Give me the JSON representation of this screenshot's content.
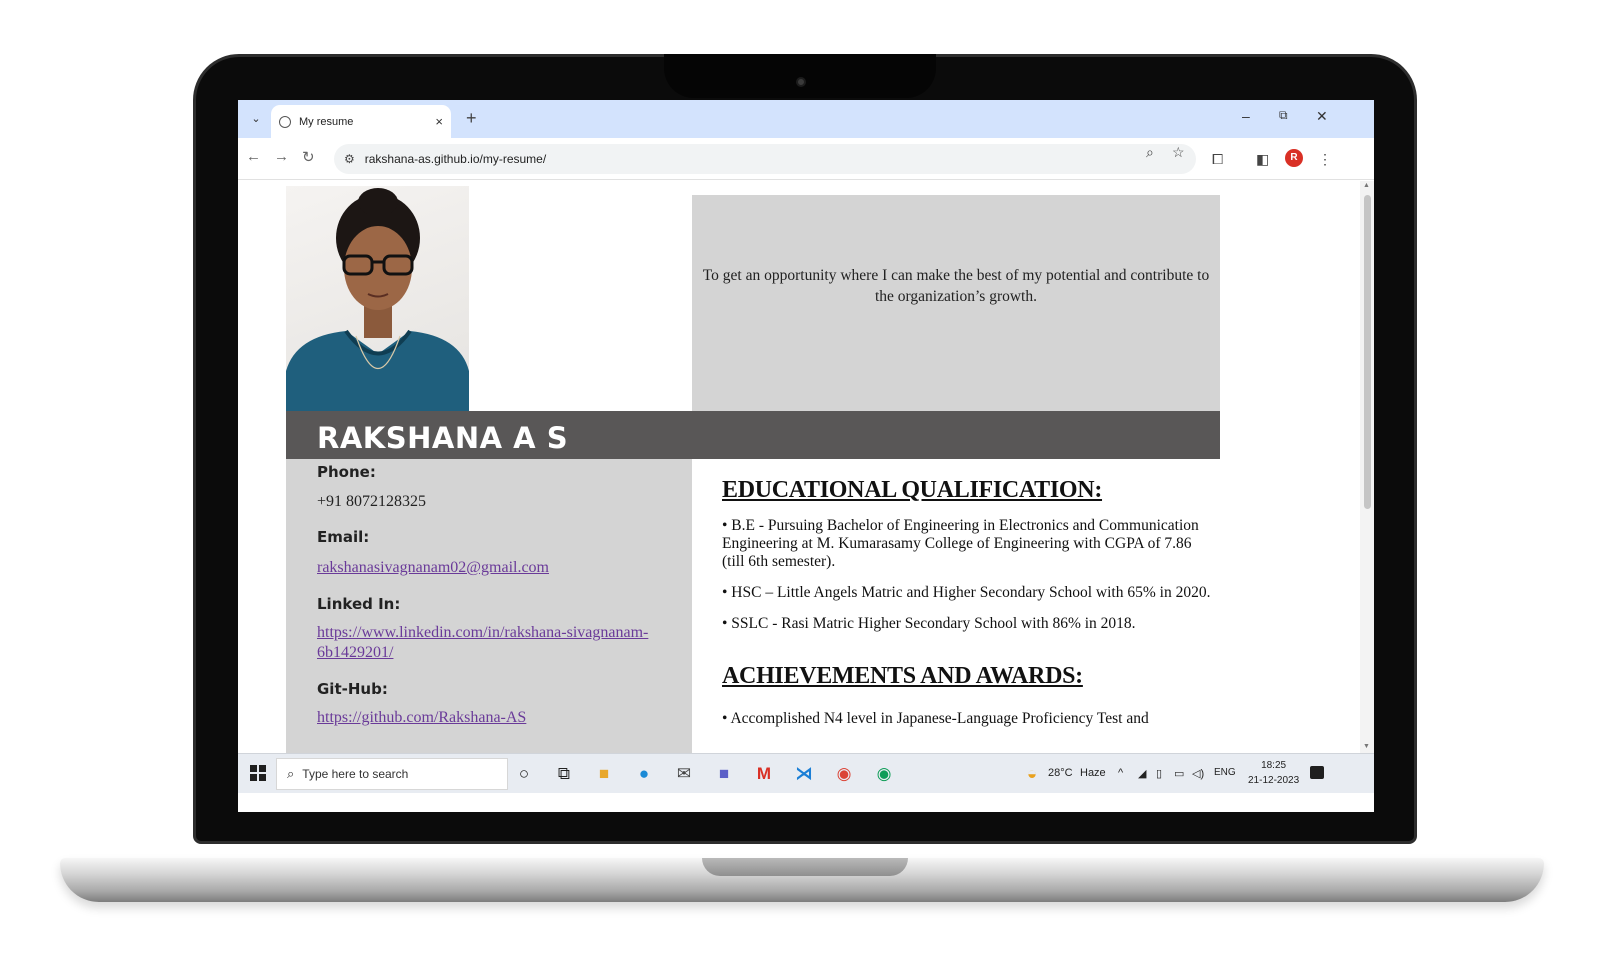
{
  "browser": {
    "tab_title": "My resume",
    "url": "rakshana-as.github.io/my-resume/",
    "profile_initial": "R",
    "window_controls": {
      "minimize": "–",
      "restore": "⧉",
      "close": "✕"
    }
  },
  "resume": {
    "objective": "To get an opportunity where I can make the best of my potential and contribute to the organization’s growth.",
    "name": "RAKSHANA A S",
    "contact": {
      "phone_label": "Phone:",
      "phone": "+91 8072128325",
      "email_label": "Email:",
      "email": "rakshanasivagnanam02@gmail.com",
      "linkedin_label": "Linked In:",
      "linkedin_line1": "https://www.linkedin.com/in/rakshana-sivagnanam-",
      "linkedin_line2": "6b1429201/",
      "github_label": "Git-Hub:",
      "github": "https://github.com/Rakshana-AS"
    },
    "education_heading": "EDUCATIONAL QUALIFICATION:",
    "education": [
      "• B.E - Pursuing Bachelor of Engineering in Electronics and Communication Engineering at M. Kumarasamy College of Engineering with CGPA of 7.86 (till 6th semester).",
      "• HSC – Little Angels Matric and Higher Secondary School with 65% in 2020.",
      "• SSLC - Rasi Matric Higher Secondary School with 86% in 2018."
    ],
    "achievements_heading": "ACHIEVEMENTS AND AWARDS:",
    "achievements": [
      "• Accomplished N4 level in Japanese-Language Proficiency Test and"
    ]
  },
  "taskbar": {
    "search_placeholder": "Type here to search",
    "weather": "28°C",
    "weather_desc": "Haze",
    "lang": "ENG",
    "time": "18:25",
    "date": "21-12-2023"
  }
}
